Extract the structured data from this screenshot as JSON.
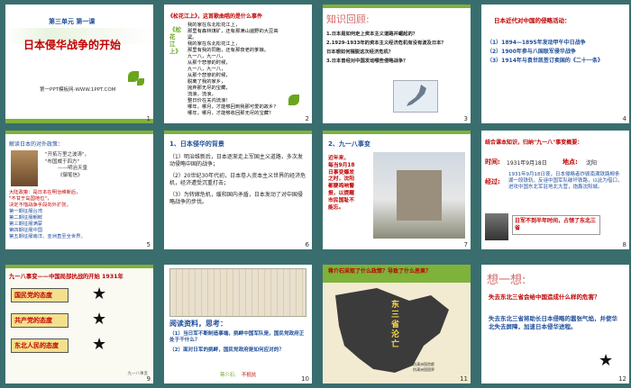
{
  "window": {
    "title": "日本侵华战争的开始 课件缩略图"
  },
  "slides": [
    {
      "num": "1",
      "unit": "第三单元  第一课",
      "title": "日本侵华战争的开始",
      "site": "第一PPT模板网-WWW.1PPT.COM"
    },
    {
      "num": "2",
      "heading": "《松花江上》，这首歌曲唱的是什么事件",
      "vertical": "《松花江上》",
      "lyrics": [
        "我的家在东北松花江上，",
        "那里有森林煤矿，还有那满山遍野的大豆高粱。",
        "我的家在东北松花江上，",
        "那里有我的同胞，还有那衰老的爹娘。",
        "九一八，九一八，",
        "从那个悲惨的时候，",
        "九一八，九一八，",
        "从那个悲惨的时候，",
        "脱离了我的家乡，",
        "抛弃那无尽的宝藏，",
        "流浪，流浪，",
        "整日价在关内流浪！",
        "哪年，哪月，才能够回到我那可爱的故乡？",
        "哪年，哪月，才能够收回那无尽的宝藏？",
        "爹娘啊，爹娘啊，",
        "什么时候才能欢聚在一堂？"
      ]
    },
    {
      "num": "3",
      "heading": "知识回顾:",
      "items": [
        "1.日本是如何走上资本主义道路并崛起的？",
        "2.1929-1933年的资本主义经济危机有没有波及日本？",
        "日本想如何摆脱这次经济危机？",
        "3.日本曾经对中国发动哪些侵略战争？"
      ]
    },
    {
      "num": "4",
      "heading": "日本近代对中国的侵略活动：",
      "items": [
        "（1）1894—1895年发动甲午中日战争",
        "（2）1900年参与八国联军侵华战争",
        "（3）1914年与袁世凯签订卖国的《二十一条》"
      ]
    },
    {
      "num": "5",
      "heading": "解读日本的对外政策：",
      "quote": [
        "\"开拓万里之波涛\"，",
        "\"布国威于四方\"",
        "——明治天皇",
        "《御笔信》"
      ],
      "body": [
        "大陆政策：是日本在明治维新后，",
        "\"不甘于岛国地位\"，",
        "决定不惜战争手段向外扩张，",
        "第一期征服台湾",
        "第二期征服朝鲜",
        "第三期征服满蒙",
        "第四期征服中国",
        "第五期征服南洋、亚洲直至全世界。"
      ]
    },
    {
      "num": "6",
      "heading": "1、日本侵华的背景",
      "items": [
        "（1）明治维新后，日本逐渐走上军国主义道路，多次发动侵略中国的战争；",
        "（2）20世纪30年代初，日本卷入资本主义世界的经济危机，经济遭受沉重打击；",
        "（3）为转嫁危机，缓和国内矛盾，日本发动了对中国侵略战争的步伐。"
      ]
    },
    {
      "num": "7",
      "heading": "2、九一八事变",
      "caption": [
        "近年来，",
        "每当9月18",
        "日事变爆发",
        "之时，沈阳",
        "都要鸣响警",
        "报，以提醒",
        "市民国耻不",
        "能忘。"
      ]
    },
    {
      "num": "8",
      "heading": "结合课本知识，归纳\"九一八\"事变概要：",
      "time_label": "时间:",
      "time_value": "1931年9月18日",
      "place_label": "地点:",
      "place_value": "沈阳",
      "process_label": "经过:",
      "process": "1931年9月18日夜，日本侵略者炸毁南满铁路柳条湖一段铁轨，反诬中国军队破坏铁路，以此为借口，进攻中国东北军驻地北大营，炮轰沈阳城。",
      "result": "日军不到半年时间，占领了东北三省"
    },
    {
      "num": "9",
      "heading": "九一八事变——中国局部抗战的开始  1931年",
      "rows": [
        "国民党的态度",
        "共产党的态度",
        "东北人民的态度"
      ],
      "footer": "九一八事变"
    },
    {
      "num": "10",
      "heading": "阅读资料，思考：",
      "questions": [
        "（1）当日军不断制造事端，挑衅中国军队是，国民党政府正处于干什么？",
        "（2）面对日军的挑衅，国民党政府是如何应对的？"
      ],
      "answer_label": "蒋介石:",
      "answer": "不抵抗"
    },
    {
      "num": "11",
      "heading": "蒋介石采取了什么政策？导致了什么恶果？",
      "label": "东三省沦亡",
      "legend": [
        "伪满洲国首都",
        "伪满洲国国界"
      ]
    },
    {
      "num": "12",
      "heading": "想一想:",
      "q": "失去东北三省会给中国造成什么样的危害？",
      "a": "失去东北三省将助长日本侵略的嚣张气焰，并使华北失去屏障，加速日本侵华进程。"
    }
  ]
}
